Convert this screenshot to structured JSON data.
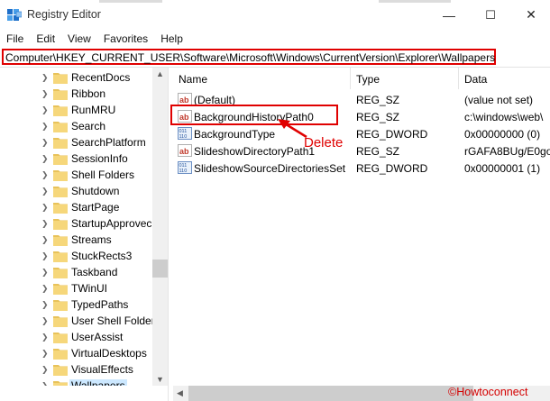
{
  "window": {
    "title": "Registry Editor",
    "controls": [
      "—",
      "☐",
      "✕"
    ]
  },
  "menu": [
    "File",
    "Edit",
    "View",
    "Favorites",
    "Help"
  ],
  "address": "Computer\\HKEY_CURRENT_USER\\Software\\Microsoft\\Windows\\CurrentVersion\\Explorer\\Wallpapers",
  "tree": {
    "items": [
      "RecentDocs",
      "Ribbon",
      "RunMRU",
      "Search",
      "SearchPlatform",
      "SessionInfo",
      "Shell Folders",
      "Shutdown",
      "StartPage",
      "StartupApprovec",
      "Streams",
      "StuckRects3",
      "Taskband",
      "TWinUI",
      "TypedPaths",
      "User Shell Folder",
      "UserAssist",
      "VirtualDesktops",
      "VisualEffects",
      "Wallpapers"
    ],
    "selected": "Wallpapers"
  },
  "list": {
    "columns": [
      "Name",
      "Type",
      "Data"
    ],
    "rows": [
      {
        "name": "(Default)",
        "type": "REG_SZ",
        "data": "(value not set)",
        "icon": "string-value-icon"
      },
      {
        "name": "BackgroundHistoryPath0",
        "type": "REG_SZ",
        "data": "c:\\windows\\web\\",
        "icon": "string-value-icon"
      },
      {
        "name": "BackgroundType",
        "type": "REG_DWORD",
        "data": "0x00000000 (0)",
        "icon": "dword-value-icon"
      },
      {
        "name": "SlideshowDirectoryPath1",
        "type": "REG_SZ",
        "data": "rGAFA8BUg/E0gou",
        "icon": "string-value-icon"
      },
      {
        "name": "SlideshowSourceDirectoriesSet",
        "type": "REG_DWORD",
        "data": "0x00000001 (1)",
        "icon": "dword-value-icon"
      }
    ]
  },
  "annotation": {
    "label": "Delete",
    "color": "#e00000"
  },
  "watermark": "©Howtoconnect"
}
